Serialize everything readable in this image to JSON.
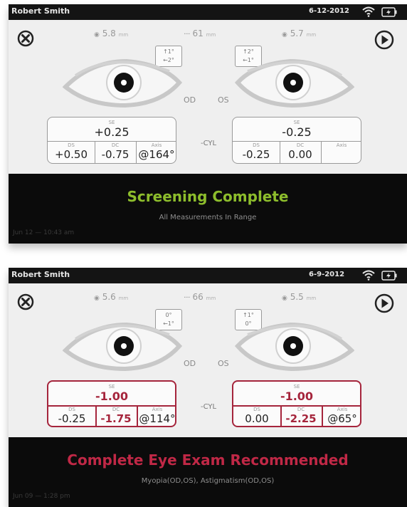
{
  "colors": {
    "complete_green": "#8dbd2c",
    "recommend_red": "#c02846",
    "box_red_border": "#a5253c"
  },
  "screens": [
    {
      "status_bar": {
        "patient_name": "Robert Smith",
        "date": "6-12-2012",
        "icons": [
          "wifi-icon",
          "battery-icon"
        ]
      },
      "buttons": {
        "close_icon": "close-icon",
        "next_icon": "play-icon"
      },
      "measurements": {
        "pupil_od": "5.8",
        "pupil_os": "5.7",
        "pd": "61",
        "unit": "mm",
        "gaze_od": [
          "↑1°",
          "←2°"
        ],
        "gaze_os": [
          "↑2°",
          "←1°"
        ]
      },
      "eye_labels": {
        "od": "OD",
        "os": "OS"
      },
      "cyl_label": "-CYL",
      "od_box": {
        "se_label": "SE",
        "se": "+0.25",
        "ds_label": "DS",
        "dc_label": "DC",
        "axis_label": "Axis",
        "ds": "+0.50",
        "dc": "-0.75",
        "axis": "@164°"
      },
      "os_box": {
        "se_label": "SE",
        "se": "-0.25",
        "ds_label": "DS",
        "dc_label": "DC",
        "axis_label": "Axis",
        "ds": "-0.25",
        "dc": "0.00",
        "axis": ""
      },
      "banner": {
        "title": "Screening Complete",
        "subtitle": "All Measurements In Range",
        "timestamp": "Jun 12 — 10:43 am"
      }
    },
    {
      "status_bar": {
        "patient_name": "Robert Smith",
        "date": "6-9-2012",
        "icons": [
          "wifi-icon",
          "battery-icon"
        ]
      },
      "buttons": {
        "close_icon": "close-icon",
        "next_icon": "play-icon"
      },
      "measurements": {
        "pupil_od": "5.6",
        "pupil_os": "5.5",
        "pd": "66",
        "unit": "mm",
        "gaze_od": [
          "0°",
          "←1°"
        ],
        "gaze_os": [
          "↑1°",
          "0°"
        ]
      },
      "eye_labels": {
        "od": "OD",
        "os": "OS"
      },
      "cyl_label": "-CYL",
      "od_box": {
        "se_label": "SE",
        "se": "-1.00",
        "ds_label": "DS",
        "dc_label": "DC",
        "axis_label": "Axis",
        "ds": "-0.25",
        "dc": "-1.75",
        "axis": "@114°"
      },
      "os_box": {
        "se_label": "SE",
        "se": "-1.00",
        "ds_label": "DS",
        "dc_label": "DC",
        "axis_label": "Axis",
        "ds": "0.00",
        "dc": "-2.25",
        "axis": "@65°"
      },
      "banner": {
        "title": "Complete Eye Exam Recommended",
        "subtitle": "Myopia(OD,OS), Astigmatism(OD,OS)",
        "timestamp": "Jun 09 — 1:28 pm"
      }
    }
  ]
}
